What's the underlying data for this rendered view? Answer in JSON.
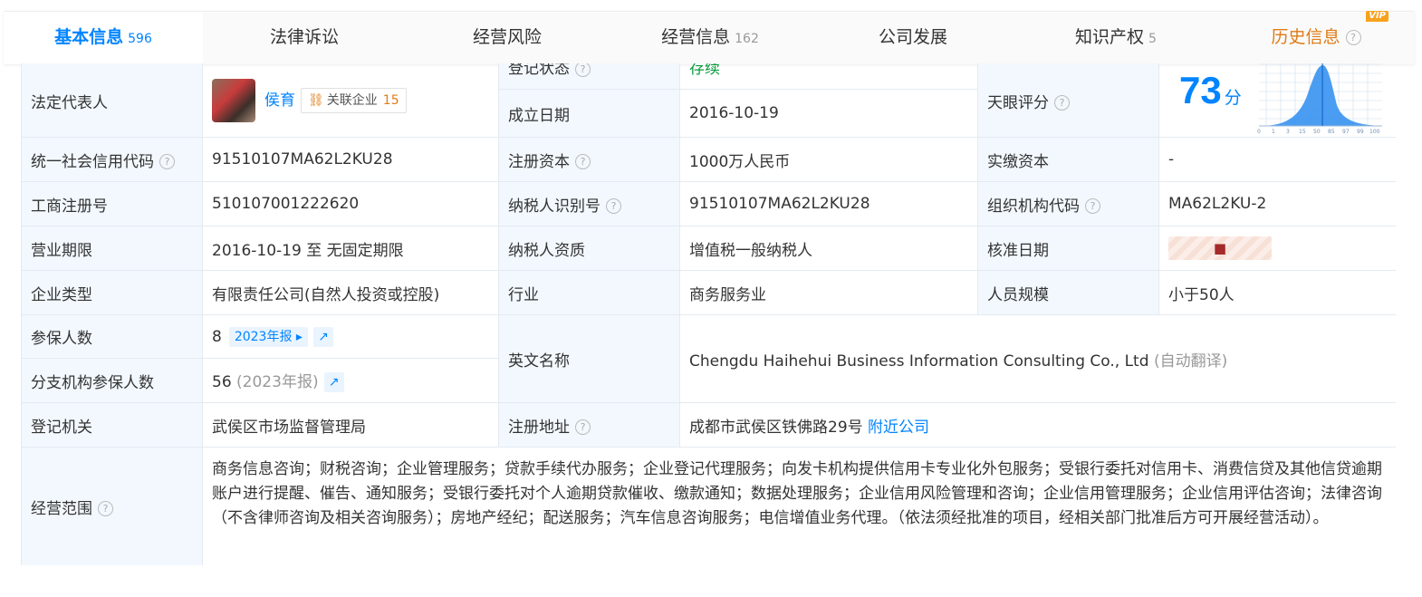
{
  "tabs": [
    {
      "label": "基本信息",
      "count": "596"
    },
    {
      "label": "法律诉讼",
      "count": ""
    },
    {
      "label": "经营风险",
      "count": ""
    },
    {
      "label": "经营信息",
      "count": "162"
    },
    {
      "label": "公司发展",
      "count": ""
    },
    {
      "label": "知识产权",
      "count": "5"
    },
    {
      "label": "历史信息",
      "count": "",
      "vip": "VIP"
    }
  ],
  "row1": {
    "legal_rep_label": "法定代表人",
    "legal_rep_name": "侯育",
    "related_label": "关联企业",
    "related_count": "15",
    "status_label": "登记状态",
    "status_value": "存续",
    "founded_label": "成立日期",
    "founded_value": "2016-10-19",
    "score_label": "天眼评分",
    "score_value": "73",
    "score_unit": "分",
    "score_axis": [
      "0",
      "1",
      "3",
      "15",
      "50",
      "85",
      "97",
      "99",
      "100"
    ]
  },
  "rows": {
    "credit_code_label": "统一社会信用代码",
    "credit_code": "91510107MA62L2KU28",
    "reg_capital_label": "注册资本",
    "reg_capital": "1000万人民币",
    "paid_capital_label": "实缴资本",
    "paid_capital": "-",
    "biz_reg_no_label": "工商注册号",
    "biz_reg_no": "510107001222620",
    "taxpayer_id_label": "纳税人识别号",
    "taxpayer_id": "91510107MA62L2KU28",
    "org_code_label": "组织机构代码",
    "org_code": "MA62L2KU-2",
    "term_label": "营业期限",
    "term": "2016-10-19 至 无固定期限",
    "tax_quality_label": "纳税人资质",
    "tax_quality": "增值税一般纳税人",
    "approve_date_label": "核准日期",
    "type_label": "企业类型",
    "type": "有限责任公司(自然人投资或控股)",
    "industry_label": "行业",
    "industry": "商务服务业",
    "staff_label": "人员规模",
    "staff": "小于50人",
    "insured_label": "参保人数",
    "insured": "8",
    "insured_tag": "2023年报",
    "branch_insured_label": "分支机构参保人数",
    "branch_insured": "56",
    "branch_insured_note": "(2023年报)",
    "english_label": "英文名称",
    "english_name": "Chengdu Haihehui Business Information Consulting Co., Ltd",
    "english_note": "(自动翻译)",
    "authority_label": "登记机关",
    "authority": "武侯区市场监督管理局",
    "address_label": "注册地址",
    "address": "成都市武侯区铁佛路29号",
    "nearby_link": "附近公司",
    "scope_label": "经营范围",
    "scope": "商务信息咨询；财税咨询；企业管理服务；贷款手续代办服务；企业登记代理服务；向发卡机构提供信用卡专业化外包服务；受银行委托对信用卡、消费信贷及其他信贷逾期账户进行提醒、催告、通知服务；受银行委托对个人逾期贷款催收、缴款通知；数据处理服务；企业信用风险管理和咨询；企业信用管理服务；企业信用评估咨询；法律咨询（不含律师咨询及相关咨询服务）；房地产经纪；配送服务；汽车信息咨询服务；电信增值业务代理。（依法须经批准的项目，经相关部门批准后方可开展经营活动）。"
  },
  "colors": {
    "accent": "#0084ff",
    "status_green": "#0a9c3e",
    "vip_orange": "#e07b16",
    "label_bg": "#f2f8fe"
  },
  "icons": {
    "help": "question-circle-icon",
    "related": "network-icon",
    "trend": "line-chart-icon",
    "lock": "lock-icon"
  }
}
